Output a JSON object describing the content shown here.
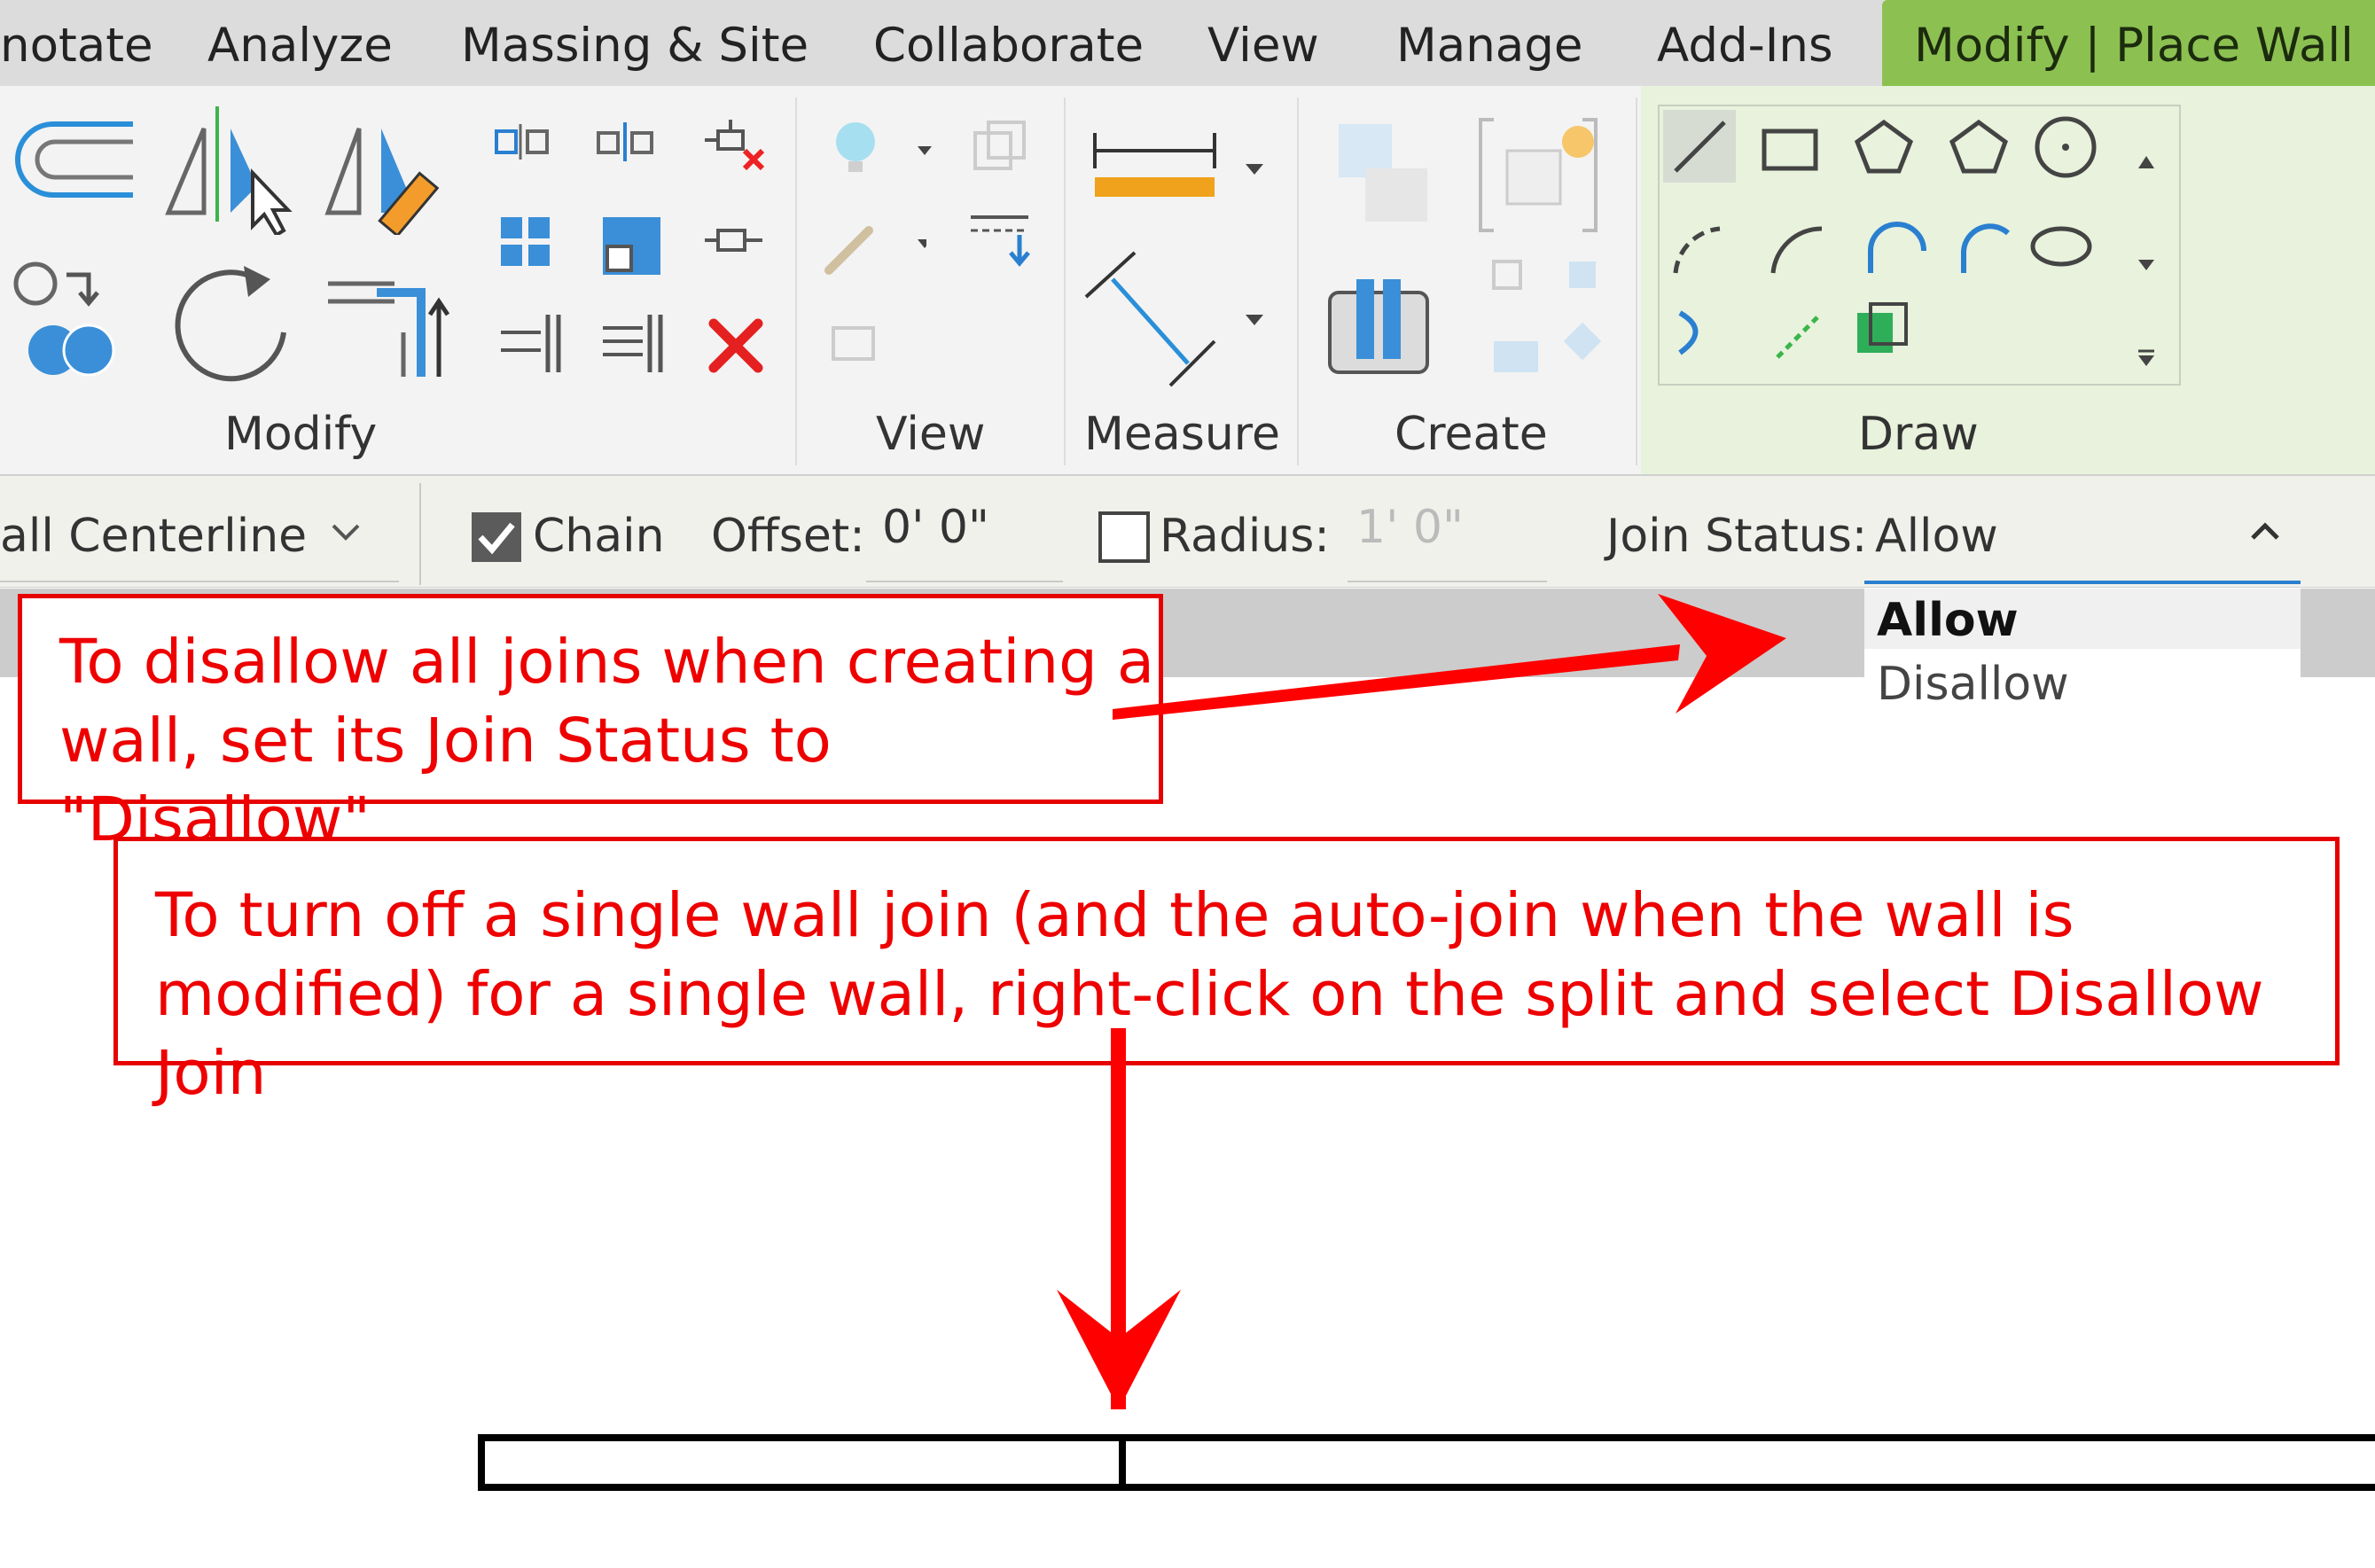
{
  "ribbon": {
    "tabs": [
      "notate",
      "Analyze",
      "Massing & Site",
      "Collaborate",
      "View",
      "Manage",
      "Add-Ins",
      "Modify | Place Wall"
    ],
    "panels": [
      "Modify",
      "View",
      "Measure",
      "Create",
      "Draw"
    ],
    "accent_color": "#8cc152"
  },
  "options_bar": {
    "location_line": "all Centerline",
    "chain_label": "Chain",
    "chain_checked": true,
    "offset_label": "Offset:",
    "offset_value": "0'  0\"",
    "radius_label": "Radius:",
    "radius_checked": false,
    "radius_value": "1'  0\"",
    "join_status_label": "Join Status:",
    "join_status_value": "Allow"
  },
  "join_dropdown": {
    "options": [
      "Allow",
      "Disallow"
    ],
    "selected": "Allow"
  },
  "callouts": {
    "top_line1": "To disallow all joins when creating a",
    "top_line2": "wall, set its Join Status to \"Disallow\"",
    "bottom_line1": "To turn off a single wall join (and the auto-join when the wall is",
    "bottom_line2": "modified) for a single wall, right-click on the split and select Disallow Join",
    "color": "#e60000"
  },
  "icons": [
    "offset-icon",
    "mirror-axis-icon",
    "mirror-draw-icon",
    "align-icon",
    "split-icon",
    "pin-icon",
    "copy-icon",
    "rotate-icon",
    "trim-icon",
    "array-icon",
    "scale-icon",
    "unpin-icon",
    "delete-icon",
    "measure-dimension-icon",
    "aligned-dimension-icon",
    "line-icon",
    "rectangle-icon",
    "polygon-icon",
    "circle-icon",
    "arc-icon",
    "pick-lines-icon",
    "pick-faces-icon"
  ]
}
